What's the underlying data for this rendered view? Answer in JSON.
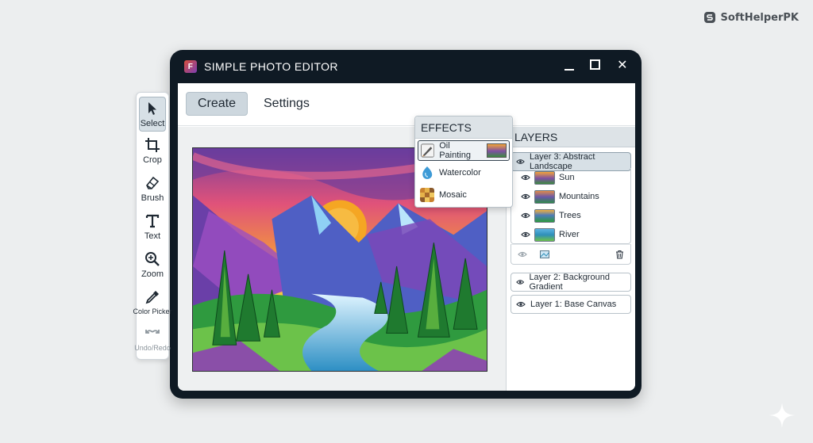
{
  "brand": {
    "name": "SoftHelperPK"
  },
  "window": {
    "title": "SIMPLE PHOTO EDITOR"
  },
  "menu": {
    "create": "Create",
    "settings": "Settings"
  },
  "tools": [
    {
      "label": "Select",
      "icon": "cursor-arrow-icon",
      "active": true
    },
    {
      "label": "Crop",
      "icon": "crop-icon"
    },
    {
      "label": "Brush",
      "icon": "eraser-brush-icon"
    },
    {
      "label": "Text",
      "icon": "text-icon"
    },
    {
      "label": "Zoom",
      "icon": "zoom-icon"
    },
    {
      "label": "Color Picker",
      "icon": "eyedropper-icon"
    },
    {
      "label": "Undo/Redo",
      "icon": "undo-redo-icon"
    }
  ],
  "effects": {
    "title": "EFFECTS",
    "items": [
      {
        "label": "Oil Painting",
        "selected": true
      },
      {
        "label": "Watercolor"
      },
      {
        "label": "Mosaic"
      }
    ]
  },
  "layers": {
    "title": "LAYERS",
    "items": [
      {
        "label": "Layer 3: Abstract Landscape",
        "active": true,
        "children": [
          {
            "label": "Sun"
          },
          {
            "label": "Mountains"
          },
          {
            "label": "Trees"
          },
          {
            "label": "River"
          }
        ]
      },
      {
        "label": "Layer 2: Background Gradient"
      },
      {
        "label": "Layer 1: Base Canvas"
      }
    ]
  },
  "colors": {
    "frame": "#0f1a24",
    "panel_header": "#dde3e7",
    "active_item": "#d7e0e6"
  }
}
